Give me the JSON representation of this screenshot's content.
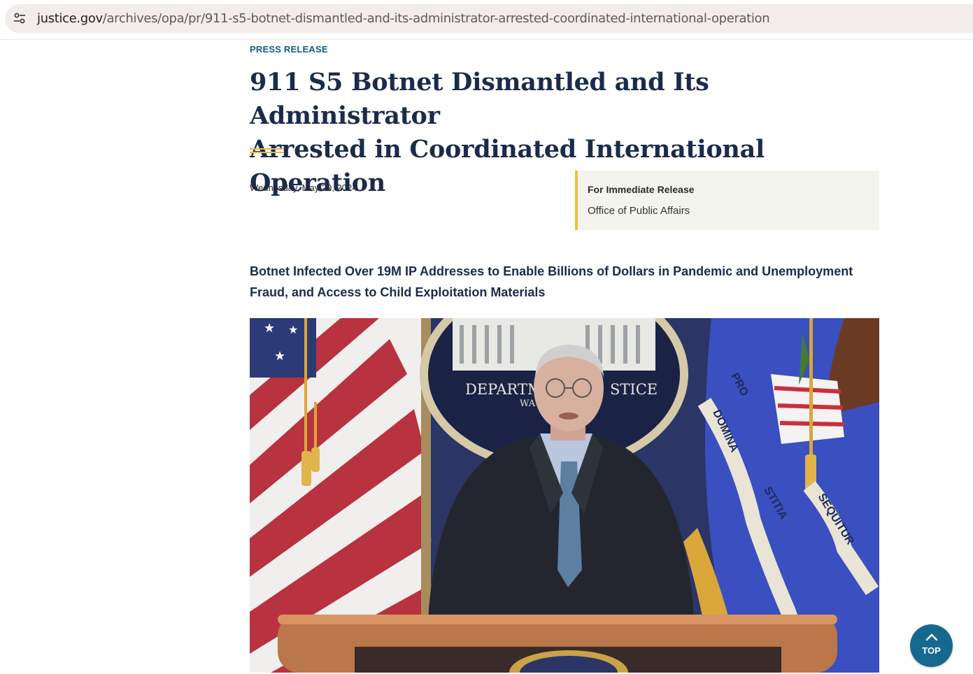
{
  "browser": {
    "url_domain": "justice.gov",
    "url_path": "/archives/opa/pr/911-s5-botnet-dismantled-and-its-administrator-arrested-coordinated-international-operation",
    "site_info_icon": "tune-icon"
  },
  "article": {
    "kicker": "PRESS RELEASE",
    "title_line1": "911 S5 Botnet Dismantled and Its Administrator",
    "title_line2": "Arrested in Coordinated International Operation",
    "date": "Wednesday, May 29, 2024",
    "release_label": "For Immediate Release",
    "office": "Office of Public Affairs",
    "subtitle": "Botnet Infected Over 19M IP Addresses to Enable Billions of Dollars in Pandemic and Unemployment Fraud, and Access to Child Exploitation Materials"
  },
  "photo": {
    "seal_text_left": "DEPARTM",
    "seal_text_right": "STICE",
    "seal_text_small": "WA",
    "flag_words": [
      "PRO",
      "DOMINA",
      "STITIA",
      "SEQUITUR"
    ]
  },
  "top_button": {
    "label": "TOP",
    "icon": "chevron-up-icon"
  },
  "colors": {
    "accent_blue": "#0f5d8a",
    "title_navy": "#1b2b4b",
    "gold": "#f0be45",
    "top_button": "#16688f"
  }
}
